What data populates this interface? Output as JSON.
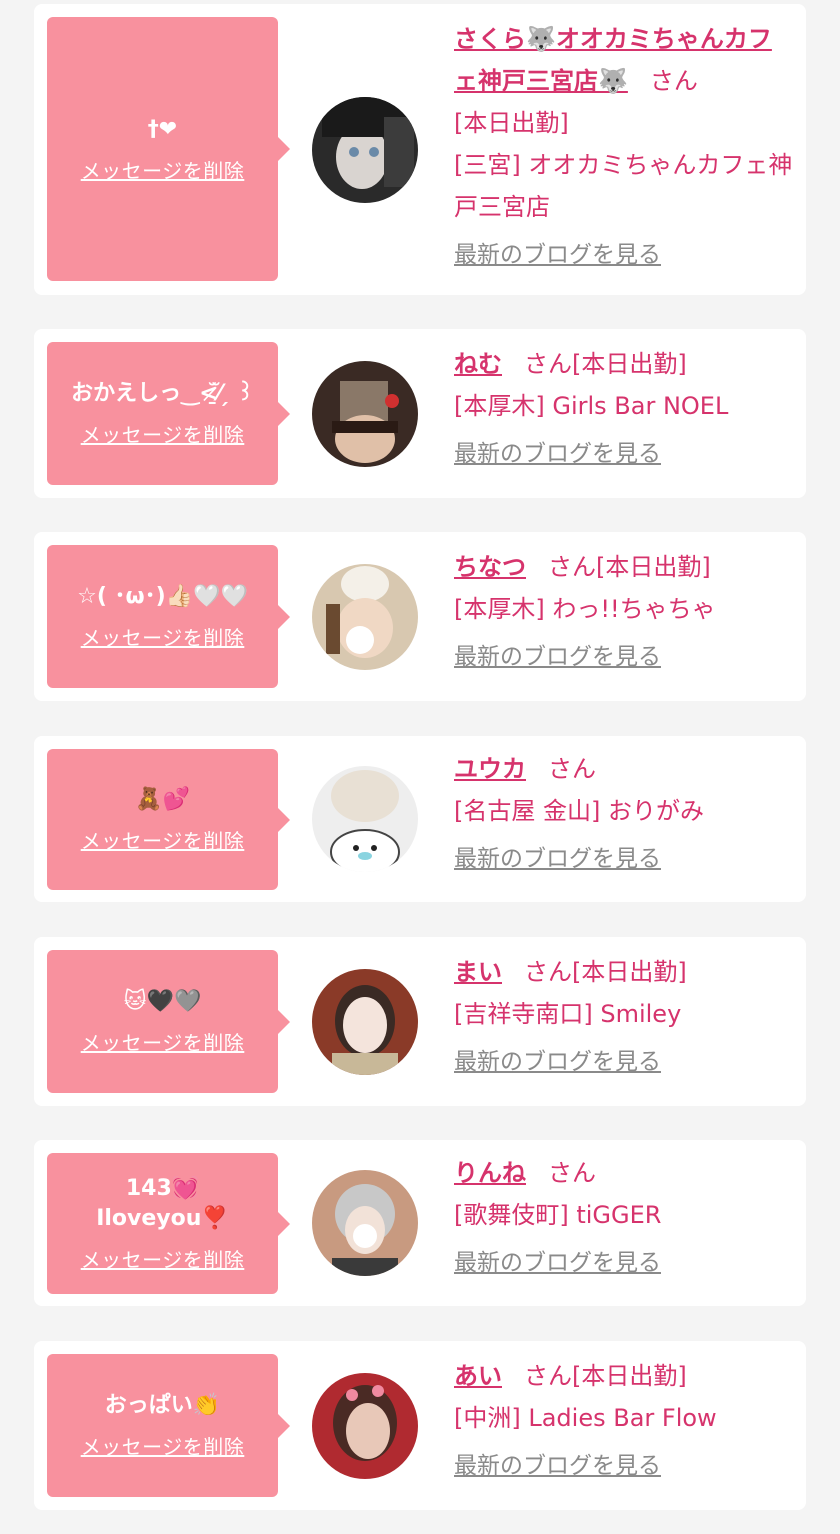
{
  "common": {
    "delete_label": "メッセージを削除",
    "blog_label": "最新のブログを見る",
    "honorific": "さん",
    "colors": {
      "bubble": "#f8919e",
      "name": "#d6336c",
      "link_gray": "#8a8a8a",
      "background": "#f4f4f4"
    }
  },
  "messages": [
    {
      "message": "†❤",
      "name": "さくら🐺オオカミちゃんカフェ神戸三宮店🐺",
      "status": "[本日出勤]",
      "shop": "[三宮] オオカミちゃんカフェ神戸三宮店"
    },
    {
      "message": "おかえしっ‿<̷̱̆⁄̆ ̗ ꒱",
      "name": "ねむ",
      "status": "[本日出勤]",
      "shop": "[本厚木] Girls Bar NOEL"
    },
    {
      "message": "☆( ･ω･)👍🏻🤍🤍",
      "name": "ちなつ",
      "status": "[本日出勤]",
      "shop": "[本厚木] わっ!!ちゃちゃ"
    },
    {
      "message": "🧸💕",
      "name": "ユウカ",
      "status": "",
      "shop": "[名古屋 金山] おりがみ"
    },
    {
      "message": "🐱🖤🩶",
      "name": "まい",
      "status": "[本日出勤]",
      "shop": "[吉祥寺南口] Smiley"
    },
    {
      "message": "143💓\nIloveyou❣️",
      "name": "りんね",
      "status": "",
      "shop": "[歌舞伎町] tiGGER"
    },
    {
      "message": "おっぱい👏",
      "name": "あい",
      "status": "[本日出勤]",
      "shop": "[中洲] Ladies Bar Flow"
    }
  ]
}
